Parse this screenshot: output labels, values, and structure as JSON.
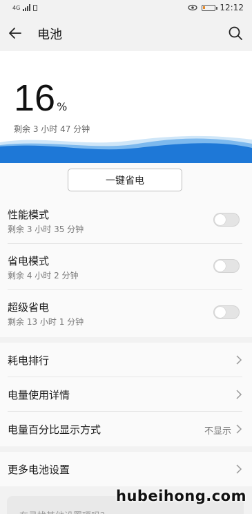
{
  "status_bar": {
    "network": "4G",
    "time": "12:12",
    "battery_level": 0.16,
    "battery_color": "#e58a2a"
  },
  "header": {
    "title": "电池",
    "back_icon": "arrow-left-icon",
    "search_icon": "search-icon"
  },
  "battery": {
    "percent": "16",
    "percent_symbol": "%",
    "remaining": "剩余 3 小时 47 分钟",
    "wave_colors": [
      "#1e78d7",
      "#7db9ee",
      "#cfe6f8"
    ]
  },
  "one_key_button": "一键省电",
  "modes": [
    {
      "title": "性能模式",
      "subtitle": "剩余 3 小时 35 分钟",
      "enabled": false
    },
    {
      "title": "省电模式",
      "subtitle": "剩余 4 小时 2 分钟",
      "enabled": false
    },
    {
      "title": "超级省电",
      "subtitle": "剩余 13 小时 1 分钟",
      "enabled": false
    }
  ],
  "menu": [
    {
      "label": "耗电排行",
      "value": ""
    },
    {
      "label": "电量使用详情",
      "value": ""
    },
    {
      "label": "电量百分比显示方式",
      "value": "不显示"
    }
  ],
  "more": {
    "label": "更多电池设置"
  },
  "hint": "在寻找其他设置项吗？",
  "watermark": "hubeihong.com"
}
